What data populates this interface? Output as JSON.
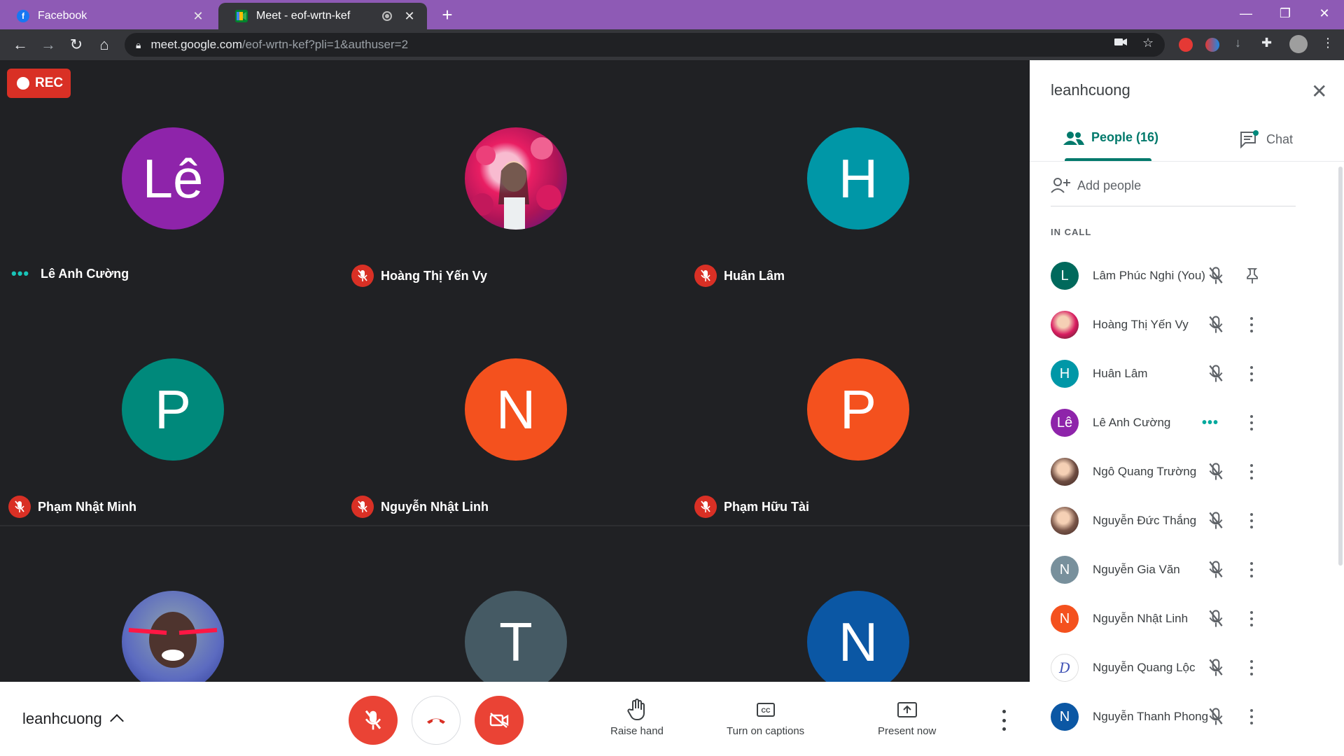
{
  "browser": {
    "tabs": [
      {
        "title": "Facebook",
        "active": false
      },
      {
        "title": "Meet - eof-wrtn-kef",
        "active": true
      }
    ],
    "url_host": "meet.google.com",
    "url_path": "/eof-wrtn-kef?pli=1&authuser=2",
    "icons": [
      "back-icon",
      "forward-icon",
      "reload-icon",
      "home-icon",
      "lock-icon",
      "camera-blocked-icon",
      "star-icon",
      "puzzle-icon"
    ]
  },
  "meet": {
    "rec_label": "REC",
    "tiles": [
      {
        "name": "Lê Anh Cường",
        "initials": "Lê",
        "color": "#8e24aa",
        "status": "speaking"
      },
      {
        "name": "Hoàng Thị Yến Vy",
        "initials": "",
        "color": "#d81b60",
        "status": "muted",
        "photo": true
      },
      {
        "name": "Huân Lâm",
        "initials": "H",
        "color": "#0097a7",
        "status": "muted"
      },
      {
        "name": "Phạm Nhật Minh",
        "initials": "P",
        "color": "#00897b",
        "status": "muted"
      },
      {
        "name": "Nguyễn Nhật Linh",
        "initials": "N",
        "color": "#f4511e",
        "status": "muted"
      },
      {
        "name": "Phạm Hữu Tài",
        "initials": "P",
        "color": "#f4511e",
        "status": "muted"
      },
      {
        "name": "",
        "initials": "",
        "color": "#5c6bc0",
        "status": "none",
        "photo": true
      },
      {
        "name": "",
        "initials": "T",
        "color": "#455a64",
        "status": "none"
      },
      {
        "name": "",
        "initials": "N",
        "color": "#0b57a4",
        "status": "none"
      }
    ],
    "meeting_name": "leanhcuong",
    "toolbar": {
      "raise_hand": "Raise hand",
      "captions": "Turn on captions",
      "present": "Present now"
    }
  },
  "panel": {
    "title": "leanhcuong",
    "people_tab": "People (16)",
    "chat_tab": "Chat",
    "add_people": "Add people",
    "in_call": "IN CALL",
    "people": [
      {
        "name": "Lâm Phúc Nghi (You)",
        "initials": "L",
        "color": "#00695c",
        "status": "muted",
        "action": "pin"
      },
      {
        "name": "Hoàng Thị Yến Vy",
        "initials": "",
        "color": "#d81b60",
        "status": "muted",
        "action": "more"
      },
      {
        "name": "Huân Lâm",
        "initials": "H",
        "color": "#0097a7",
        "status": "muted",
        "action": "more"
      },
      {
        "name": "Lê Anh Cường",
        "initials": "Lê",
        "color": "#8e24aa",
        "status": "speaking",
        "action": "more"
      },
      {
        "name": "Ngô Quang Trường",
        "initials": "",
        "color": "#6d4c41",
        "status": "muted",
        "action": "more"
      },
      {
        "name": "Nguyễn Đức Thắng",
        "initials": "",
        "color": "#795548",
        "status": "muted",
        "action": "more"
      },
      {
        "name": "Nguyễn Gia Văn",
        "initials": "N",
        "color": "#78909c",
        "status": "muted",
        "action": "more"
      },
      {
        "name": "Nguyễn Nhật Linh",
        "initials": "N",
        "color": "#f4511e",
        "status": "muted",
        "action": "more"
      },
      {
        "name": "Nguyễn Quang Lộc",
        "initials": "D",
        "color": "#ffffff",
        "status": "muted",
        "action": "more"
      },
      {
        "name": "Nguyễn Thanh Phong",
        "initials": "N",
        "color": "#0b57a4",
        "status": "muted",
        "action": "more"
      }
    ]
  }
}
